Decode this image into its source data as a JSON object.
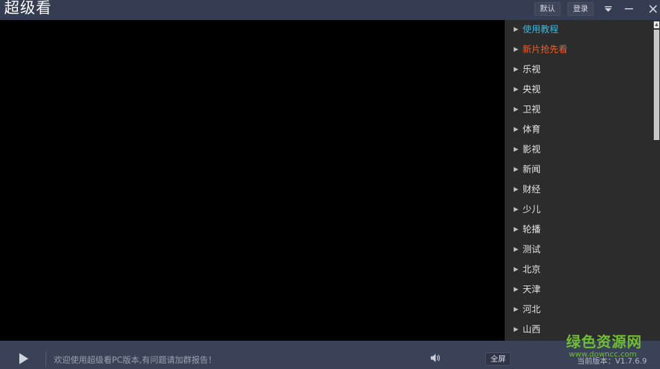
{
  "titlebar": {
    "app_title": "超级看",
    "default_label": "默认",
    "login_label": "登录"
  },
  "icons": {
    "menu": "menu-dropdown-icon",
    "minimize": "minimize-icon",
    "close": "close-icon",
    "play": "play-icon",
    "volume": "volume-icon"
  },
  "sidebar": {
    "channels": [
      {
        "label": "使用教程",
        "color": "#35b8e0"
      },
      {
        "label": "新片抢先看",
        "color": "#ff5a1f"
      },
      {
        "label": "乐视"
      },
      {
        "label": "央视"
      },
      {
        "label": "卫视"
      },
      {
        "label": "体育"
      },
      {
        "label": "影视"
      },
      {
        "label": "新闻"
      },
      {
        "label": "财经"
      },
      {
        "label": "少儿"
      },
      {
        "label": "轮播"
      },
      {
        "label": "测试"
      },
      {
        "label": "北京"
      },
      {
        "label": "天津"
      },
      {
        "label": "河北"
      },
      {
        "label": "山西"
      }
    ]
  },
  "bottombar": {
    "welcome_text": "欢迎使用超级看PC版本,有问题请加群报告！",
    "fullscreen_label": "全屏",
    "version_text": "当前版本：V1.7.6.9"
  },
  "watermark": {
    "main": "绿色资源网",
    "sub": "www.downcc.com"
  },
  "colors": {
    "titlebar_bg": "#353d52",
    "sidebar_bg": "#2c2c2c",
    "video_bg": "#000000",
    "accent_blue": "#35b8e0",
    "accent_orange": "#ff5a1f",
    "watermark_green": "#6fbf2f"
  }
}
